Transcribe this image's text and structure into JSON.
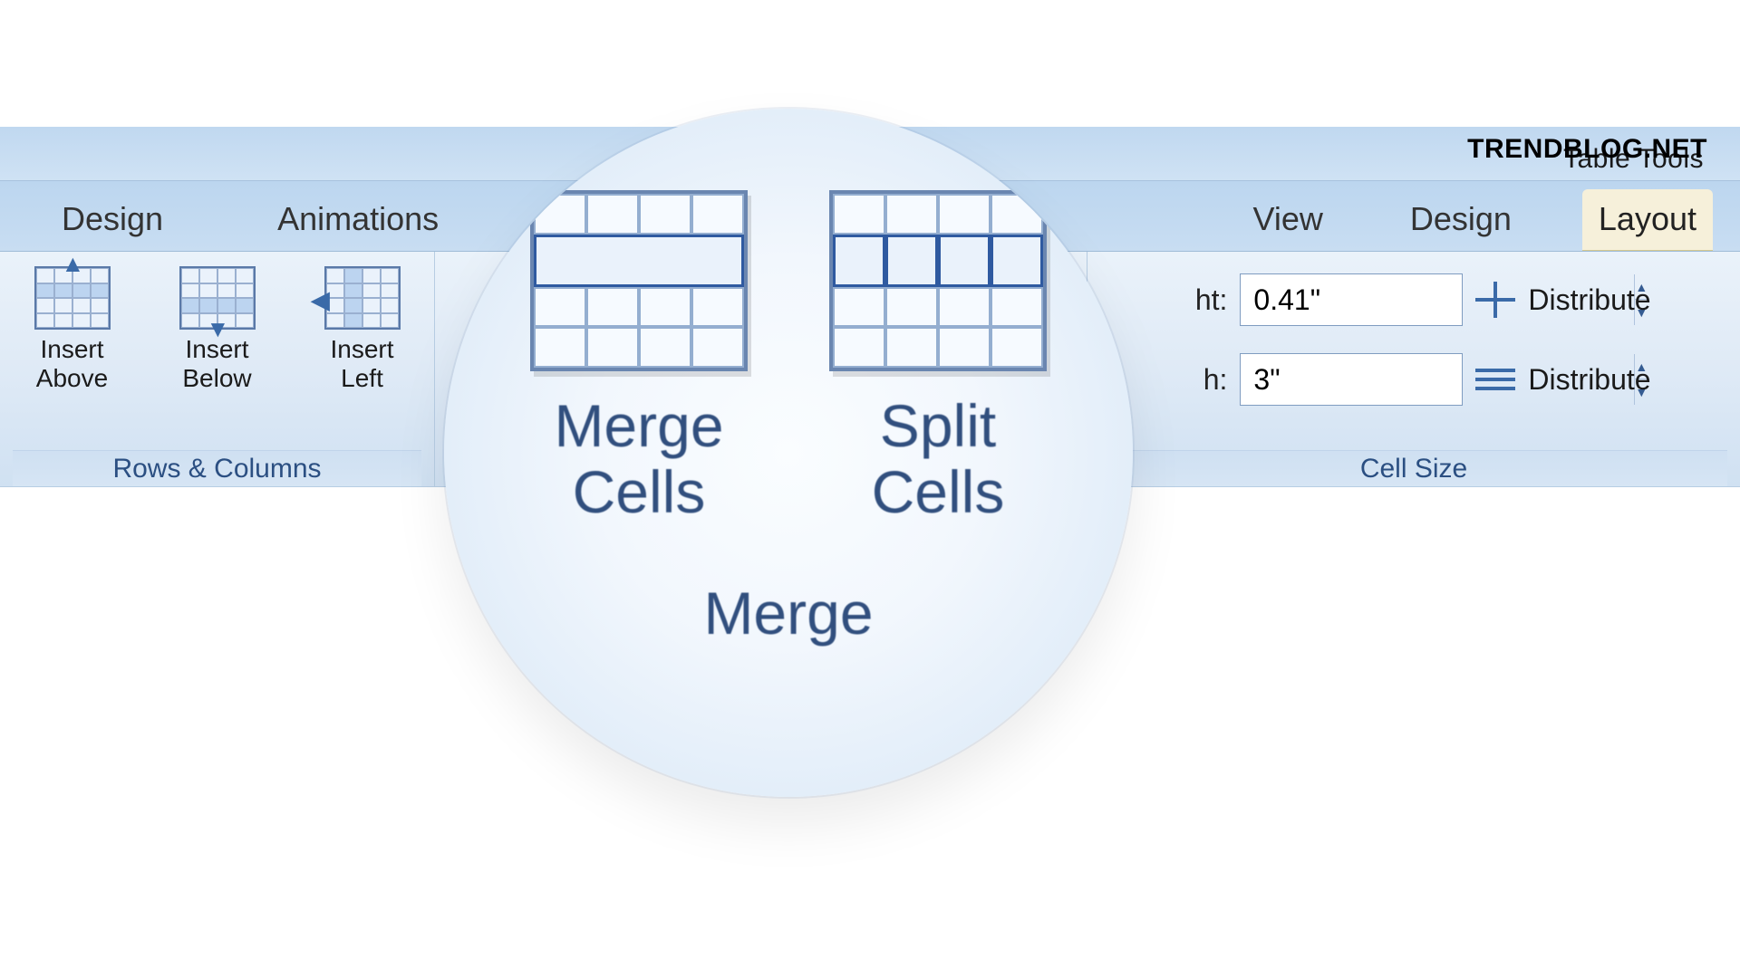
{
  "watermark": "TRENDBLOG.NET",
  "titlebar": {
    "table_tools": "Table Tools"
  },
  "tabs": {
    "design": "Design",
    "animations": "Animations",
    "view": "View",
    "design2": "Design",
    "layout": "Layout"
  },
  "rows_columns": {
    "group_title": "Rows & Columns",
    "insert_above": "Insert\nAbove",
    "insert_below": "Insert\nBelow",
    "insert_left": "Insert\nLeft"
  },
  "merge_group": {
    "group_title": "Merge",
    "merge_cells": "Merge\nCells",
    "split_cells": "Split\nCells"
  },
  "cell_size": {
    "group_title": "Cell Size",
    "height_label": "ht:",
    "height_value": "0.41\"",
    "width_label": "h:",
    "width_value": "3\"",
    "distribute_rows": "Distribute",
    "distribute_cols": "Distribute"
  }
}
